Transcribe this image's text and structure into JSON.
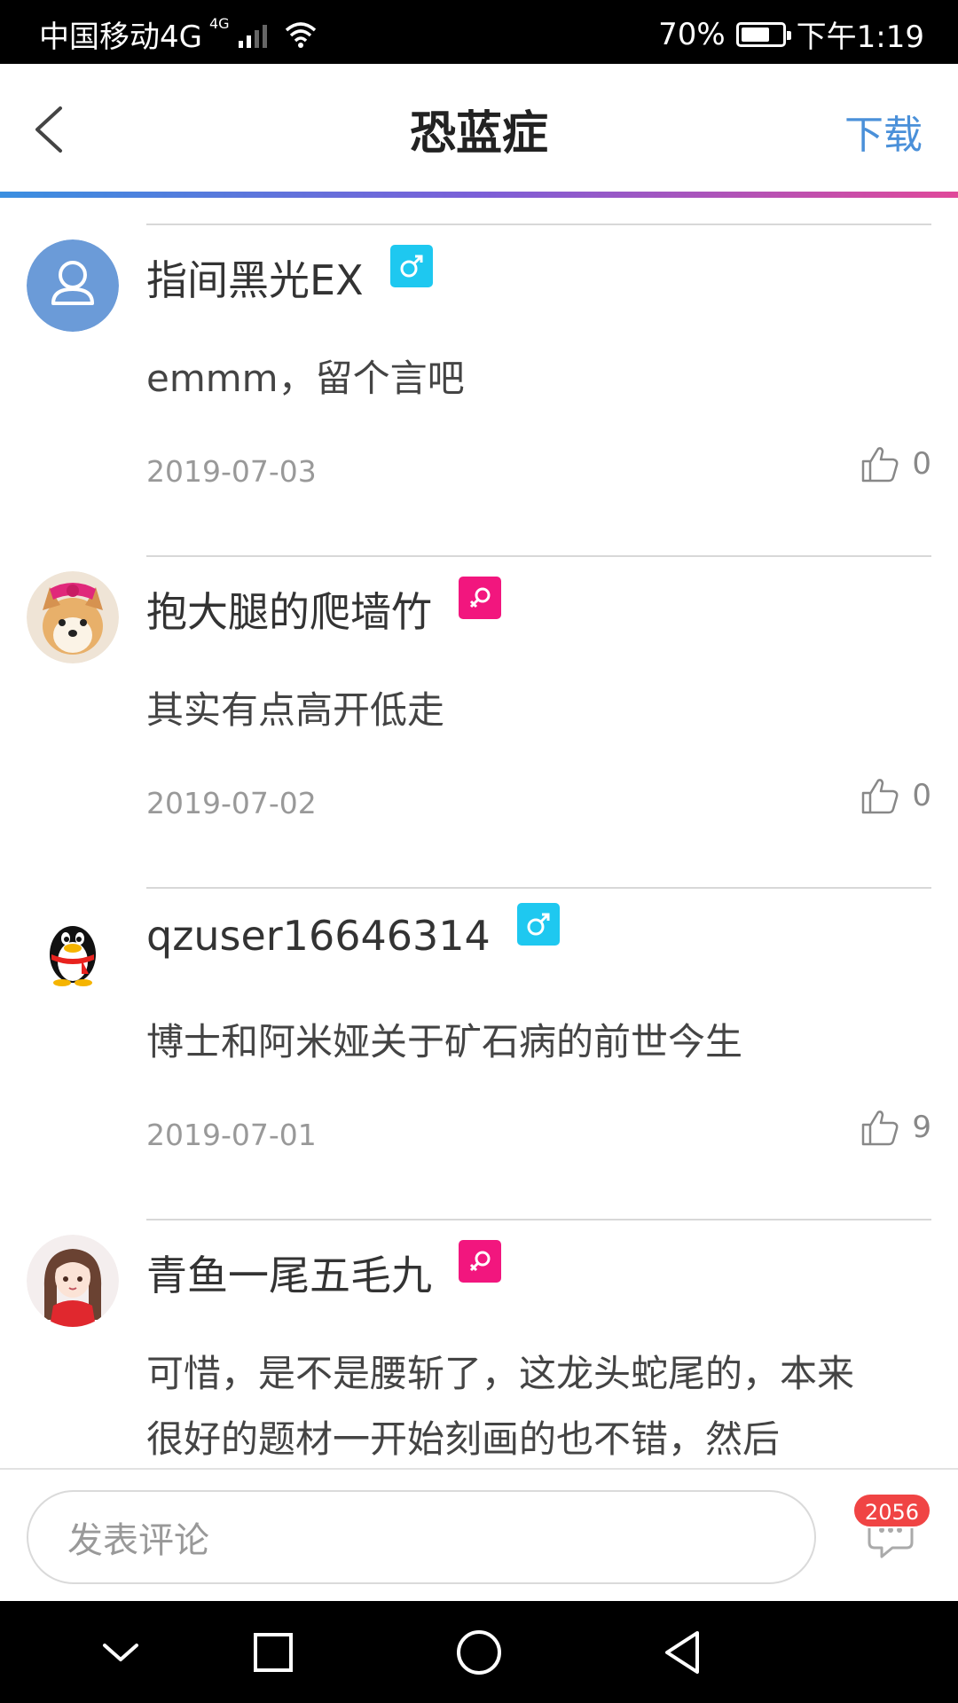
{
  "status_bar": {
    "carrier": "中国移动4G",
    "net_badge": "4G",
    "battery_percent": "70%",
    "battery_level": 0.7,
    "time": "下午1:19"
  },
  "header": {
    "title": "恐蓝症",
    "action_label": "下载",
    "back_icon": "chevron-left-icon"
  },
  "colors": {
    "accent_blue": "#4a90d9",
    "male_badge": "#1ec8f0",
    "female_badge": "#f2167e",
    "gradient_start": "#3a8fe0",
    "gradient_end": "#e0489a"
  },
  "comments": [
    {
      "username": "指间黑光EX",
      "gender": "male",
      "text": "emmm，留个言吧",
      "date": "2019-07-03",
      "likes": "0",
      "avatar": "default-user-avatar"
    },
    {
      "username": "抱大腿的爬墙竹",
      "gender": "female",
      "text": "其实有点高开低走",
      "date": "2019-07-02",
      "likes": "0",
      "avatar": "shiba-dog-avatar"
    },
    {
      "username": "qzuser16646314",
      "gender": "male",
      "text": "博士和阿米娅关于矿石病的前世今生",
      "date": "2019-07-01",
      "likes": "9",
      "avatar": "qq-penguin-avatar"
    },
    {
      "username": "青鱼一尾五毛九",
      "gender": "female",
      "text": "可惜，是不是腰斩了，这龙头蛇尾的，本来很好的题材一开始刻画的也不错，然后",
      "date": "",
      "likes": "",
      "avatar": "anime-girl-avatar"
    }
  ],
  "comment_box": {
    "placeholder": "发表评论",
    "comment_count": "2056"
  }
}
